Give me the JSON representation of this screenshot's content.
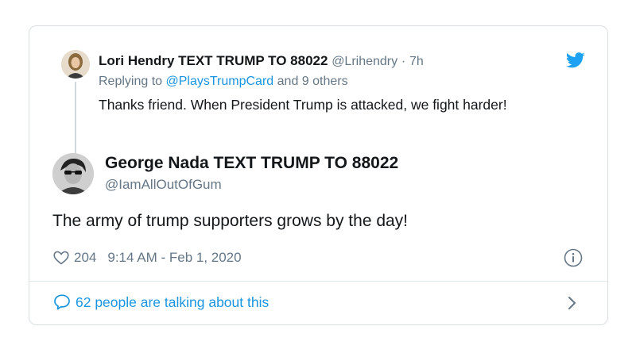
{
  "parent_tweet": {
    "name": "Lori Hendry TEXT TRUMP TO 88022",
    "handle": "@Lrihendry",
    "separator": "·",
    "time": "7h",
    "replying_prefix": "Replying to",
    "replying_to": "@PlaysTrumpCard",
    "replying_suffix": "and 9 others",
    "text": "Thanks friend. When President Trump is attacked, we fight harder!"
  },
  "main_tweet": {
    "name": "George Nada TEXT TRUMP TO 88022",
    "handle": "@IamAllOutOfGum",
    "text": "The army of trump supporters grows by the day!",
    "likes": "204",
    "timestamp": "9:14 AM - Feb 1, 2020"
  },
  "footer": {
    "talking_text": "62 people are talking about this"
  },
  "icons": {
    "bird": "twitter-bird-icon",
    "heart": "heart-icon",
    "info": "info-icon",
    "bubble": "speech-bubble-icon",
    "chevron": "chevron-right-icon"
  },
  "colors": {
    "accent": "#1b95e0",
    "muted": "#657786",
    "text": "#14171a",
    "border": "#d9dee3"
  }
}
